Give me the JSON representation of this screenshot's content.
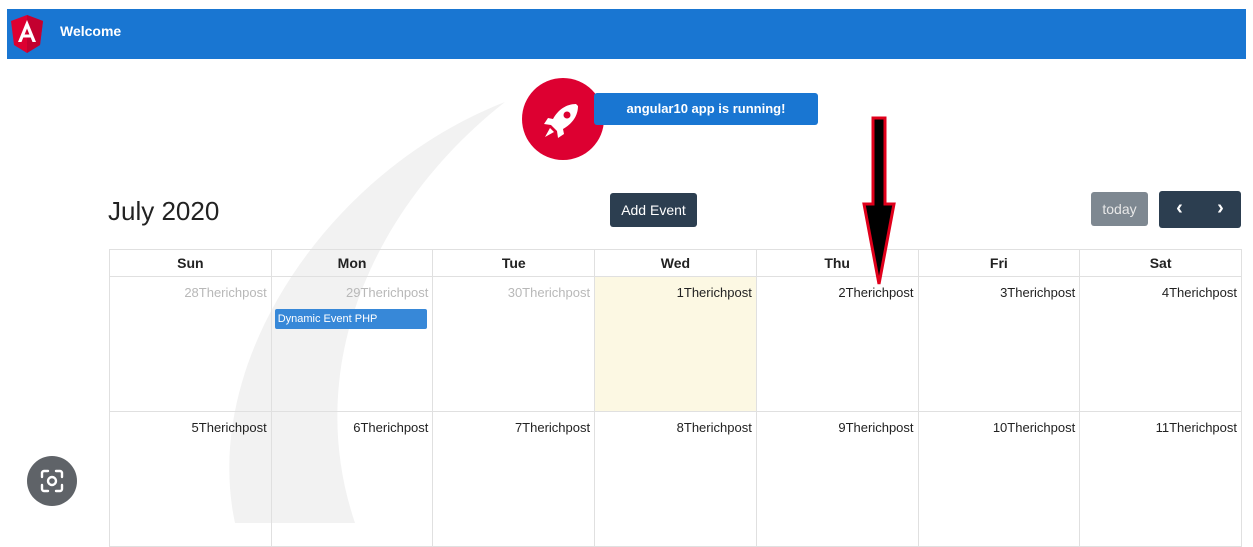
{
  "header": {
    "title": "Welcome",
    "logo_icon": "angular-logo-icon",
    "brand_color": "#1976d2"
  },
  "banner": {
    "icon": "rocket-icon",
    "message": "angular10 app is running!",
    "badge_color": "#dd0031"
  },
  "toolbar": {
    "month_title": "July 2020",
    "add_event_label": "Add Event",
    "today_label": "today",
    "prev_symbol": "‹",
    "next_symbol": "›"
  },
  "calendar": {
    "weekdays": [
      "Sun",
      "Mon",
      "Tue",
      "Wed",
      "Thu",
      "Fri",
      "Sat"
    ],
    "weeks": [
      [
        {
          "label": "28Therichpost",
          "other_month": true
        },
        {
          "label": "29Therichpost",
          "other_month": true
        },
        {
          "label": "30Therichpost",
          "other_month": true
        },
        {
          "label": "1Therichpost",
          "today": true
        },
        {
          "label": "2Therichpost"
        },
        {
          "label": "3Therichpost"
        },
        {
          "label": "4Therichpost"
        }
      ],
      [
        {
          "label": "5Therichpost"
        },
        {
          "label": "6Therichpost"
        },
        {
          "label": "7Therichpost"
        },
        {
          "label": "8Therichpost"
        },
        {
          "label": "9Therichpost"
        },
        {
          "label": "10Therichpost"
        },
        {
          "label": "11Therichpost"
        }
      ]
    ],
    "event": {
      "title": "Dynamic Event PHP",
      "day": "29"
    }
  },
  "overlay": {
    "lens_icon": "google-lens-icon",
    "annotation_icon": "red-down-arrow-icon"
  }
}
